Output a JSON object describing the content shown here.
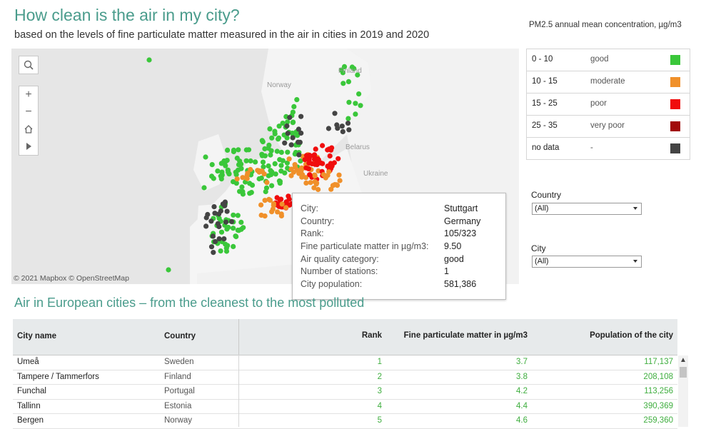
{
  "header": {
    "title": "How clean is the air in my city?",
    "subtitle": "based on the levels of fine particulate matter measured in the air in cities in 2019 and 2020"
  },
  "map": {
    "attribution": "© 2021 Mapbox © OpenStreetMap",
    "labels": {
      "finland": "Finland",
      "norway": "Norway",
      "belarus": "Belarus",
      "ukraine": "Ukraine"
    },
    "controls": {
      "search_icon": "search-icon",
      "zoom_in": "+",
      "zoom_out": "−",
      "home_icon": "home-icon",
      "play_icon": "play-icon"
    },
    "colors": {
      "good": "#3ac73a",
      "moderate": "#f0902a",
      "poor": "#f00d0d",
      "very_poor": "#a10b0b",
      "no_data": "#444444"
    },
    "tooltip": {
      "rows": [
        {
          "label": "City:",
          "value": "Stuttgart"
        },
        {
          "label": "Country:",
          "value": "Germany"
        },
        {
          "label": "Rank:",
          "value": "105/323"
        },
        {
          "label": "Fine particulate matter in µg/m3:",
          "value": "9.50"
        },
        {
          "label": "Air quality category:",
          "value": "good"
        },
        {
          "label": "Number of stations:",
          "value": "1"
        },
        {
          "label": "City population:",
          "value": "581,386"
        }
      ]
    }
  },
  "legend": {
    "title": "PM2.5 annual mean concentration, µg/m3",
    "rows": [
      {
        "range": "0 - 10",
        "category": "good",
        "color": "#3ac73a"
      },
      {
        "range": "10 - 15",
        "category": "moderate",
        "color": "#f0902a"
      },
      {
        "range": "15 - 25",
        "category": "poor",
        "color": "#f00d0d"
      },
      {
        "range": "25 - 35",
        "category": "very poor",
        "color": "#a10b0b"
      },
      {
        "range": "no data",
        "category": "-",
        "color": "#444444"
      }
    ]
  },
  "filters": {
    "country": {
      "label": "Country",
      "value": "(All)"
    },
    "city": {
      "label": "City",
      "value": "(All)"
    }
  },
  "table": {
    "title": "Air in European cities – from the cleanest to the most polluted",
    "headers": {
      "city": "City name",
      "country": "Country",
      "rank": "Rank",
      "pm": "Fine particulate matter in µg/m3",
      "population": "Population of the city"
    },
    "rows": [
      {
        "city": "Umeå",
        "country": "Sweden",
        "rank": "1",
        "pm": "3.7",
        "population": "117,137"
      },
      {
        "city": "Tampere / Tammerfors",
        "country": "Finland",
        "rank": "2",
        "pm": "3.8",
        "population": "208,108"
      },
      {
        "city": "Funchal",
        "country": "Portugal",
        "rank": "3",
        "pm": "4.2",
        "population": "113,256"
      },
      {
        "city": "Tallinn",
        "country": "Estonia",
        "rank": "4",
        "pm": "4.4",
        "population": "390,369"
      },
      {
        "city": "Bergen",
        "country": "Norway",
        "rank": "5",
        "pm": "4.6",
        "population": "259,360"
      }
    ]
  }
}
